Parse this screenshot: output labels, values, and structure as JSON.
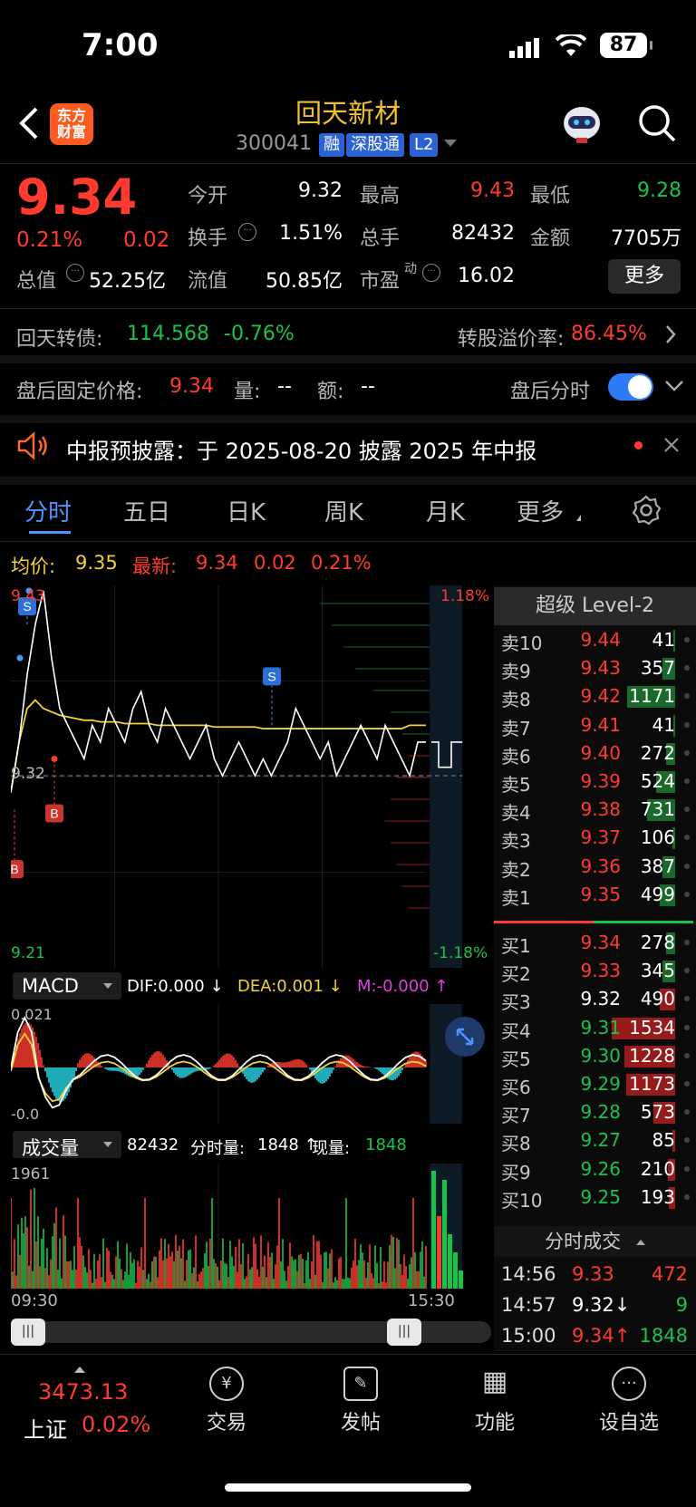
{
  "status": {
    "time": "7:00",
    "battery": "87"
  },
  "header": {
    "logo_line1": "东方",
    "logo_line2": "财富",
    "name": "回天新材",
    "code": "300041",
    "tags": [
      "融",
      "深股通",
      "L2"
    ]
  },
  "quote": {
    "price": "9.34",
    "pct": "0.21%",
    "chg": "0.02",
    "open_label": "今开",
    "open": "9.32",
    "high_label": "最高",
    "high": "9.43",
    "low_label": "最低",
    "low": "9.28",
    "turnover_label": "换手",
    "turnover": "1.51%",
    "volume_label": "总手",
    "volume": "82432",
    "amount_label": "金额",
    "amount": "7705万",
    "mktcap_label": "总值",
    "mktcap": "52.25亿",
    "float_label": "流值",
    "float": "50.85亿",
    "pe_label": "市盈",
    "pe_sup": "动",
    "pe": "16.02",
    "more": "更多"
  },
  "bond": {
    "label": "回天转债:",
    "price": "114.568",
    "pct": "-0.76%",
    "premium_label": "转股溢价率:",
    "premium": "86.45%"
  },
  "after_hours": {
    "label": "盘后固定价格:",
    "price": "9.34",
    "vol_label": "量:",
    "vol": "--",
    "amt_label": "额:",
    "amt": "--",
    "toggle_label": "盘后分时",
    "toggle_on": true
  },
  "notice": {
    "text": "中报预披露：于 2025-08-20 披露 2025 年中报"
  },
  "tabs": [
    "分时",
    "五日",
    "日K",
    "周K",
    "月K",
    "更多"
  ],
  "chart_info": {
    "avg_label": "均价:",
    "avg": "9.35",
    "latest_label": "最新:",
    "latest": "9.34",
    "chg": "0.02",
    "pct": "0.21%"
  },
  "chart_data": {
    "type": "line",
    "price_high": "9.43",
    "price_low": "9.21",
    "ref": "9.32",
    "pct_high": "1.18%",
    "pct_low": "-1.18%",
    "time_start": "09:30",
    "time_end": "15:30",
    "ylim": [
      9.21,
      9.43
    ],
    "price": [
      9.31,
      9.34,
      9.38,
      9.41,
      9.43,
      9.39,
      9.36,
      9.35,
      9.34,
      9.33,
      9.35,
      9.34,
      9.36,
      9.35,
      9.34,
      9.36,
      9.37,
      9.35,
      9.34,
      9.36,
      9.35,
      9.34,
      9.33,
      9.34,
      9.35,
      9.33,
      9.32,
      9.33,
      9.34,
      9.33,
      9.32,
      9.33,
      9.32,
      9.33,
      9.34,
      9.36,
      9.35,
      9.34,
      9.33,
      9.34,
      9.32,
      9.33,
      9.34,
      9.35,
      9.34,
      9.33,
      9.35,
      9.34,
      9.33,
      9.32,
      9.34,
      9.34
    ],
    "avg": [
      9.31,
      9.34,
      9.36,
      9.365,
      9.36,
      9.358,
      9.356,
      9.355,
      9.354,
      9.353,
      9.353,
      9.352,
      9.352,
      9.352,
      9.351,
      9.351,
      9.351,
      9.351,
      9.35,
      9.35,
      9.35,
      9.35,
      9.35,
      9.35,
      9.35,
      9.349,
      9.349,
      9.349,
      9.349,
      9.349,
      9.349,
      9.348,
      9.348,
      9.348,
      9.348,
      9.348,
      9.348,
      9.348,
      9.348,
      9.348,
      9.348,
      9.348,
      9.348,
      9.348,
      9.348,
      9.348,
      9.348,
      9.348,
      9.348,
      9.35,
      9.35,
      9.35
    ],
    "macd_label": "MACD",
    "dif": "DIF:0.000 ↓",
    "dea": "DEA:0.001 ↓",
    "m": "M:-0.000 ↑",
    "macd_top": "0.021",
    "macd_bottom": "-0.0",
    "vol_label": "成交量",
    "vol_total": "82432",
    "vol_min_label": "分时量:",
    "vol_min": "1848 ↑",
    "vol_now_label": "现量:",
    "vol_now": "1848",
    "vol_max": "1961"
  },
  "orderbook": {
    "title": "超级 Level-2",
    "asks": [
      {
        "label": "卖10",
        "price": "9.44",
        "vol": "41",
        "bar": 0.02,
        "color": "#ff3b30"
      },
      {
        "label": "卖9",
        "price": "9.43",
        "vol": "357",
        "bar": 0.2,
        "color": "#ff3b30"
      },
      {
        "label": "卖8",
        "price": "9.42",
        "vol": "1171",
        "bar": 0.76,
        "color": "#ff3b30"
      },
      {
        "label": "卖7",
        "price": "9.41",
        "vol": "41",
        "bar": 0.02,
        "color": "#ff3b30"
      },
      {
        "label": "卖6",
        "price": "9.40",
        "vol": "272",
        "bar": 0.15,
        "color": "#ff3b30"
      },
      {
        "label": "卖5",
        "price": "9.39",
        "vol": "524",
        "bar": 0.3,
        "color": "#ff3b30"
      },
      {
        "label": "卖4",
        "price": "9.38",
        "vol": "731",
        "bar": 0.45,
        "color": "#ff3b30"
      },
      {
        "label": "卖3",
        "price": "9.37",
        "vol": "106",
        "bar": 0.05,
        "color": "#ff3b30"
      },
      {
        "label": "卖2",
        "price": "9.36",
        "vol": "387",
        "bar": 0.2,
        "color": "#ff3b30"
      },
      {
        "label": "卖1",
        "price": "9.35",
        "vol": "499",
        "bar": 0.25,
        "color": "#ff3b30"
      }
    ],
    "bids": [
      {
        "label": "买1",
        "price": "9.34",
        "vol": "278",
        "bar": 0.15,
        "color": "#ff3b30"
      },
      {
        "label": "买2",
        "price": "9.33",
        "vol": "345",
        "bar": 0.2,
        "color": "#ff3b30"
      },
      {
        "label": "买3",
        "price": "9.32",
        "vol": "490",
        "bar": 0.25,
        "color": "#ffffff"
      },
      {
        "label": "买4",
        "price": "9.31",
        "vol": "1534",
        "bar": 1.0,
        "color": "#19c34a"
      },
      {
        "label": "买5",
        "price": "9.30",
        "vol": "1228",
        "bar": 0.8,
        "color": "#19c34a"
      },
      {
        "label": "买6",
        "price": "9.29",
        "vol": "1173",
        "bar": 0.77,
        "color": "#19c34a"
      },
      {
        "label": "买7",
        "price": "9.28",
        "vol": "573",
        "bar": 0.35,
        "color": "#19c34a"
      },
      {
        "label": "买8",
        "price": "9.27",
        "vol": "85",
        "bar": 0.05,
        "color": "#19c34a"
      },
      {
        "label": "买9",
        "price": "9.26",
        "vol": "210",
        "bar": 0.12,
        "color": "#19c34a"
      },
      {
        "label": "买10",
        "price": "9.25",
        "vol": "193",
        "bar": 0.1,
        "color": "#19c34a"
      }
    ]
  },
  "ticks": {
    "title": "分时成交",
    "rows": [
      {
        "time": "14:56",
        "price": "9.33",
        "vol": "472",
        "pcolor": "#ff3b30",
        "vcolor": "#ff3b30"
      },
      {
        "time": "14:57",
        "price": "9.32↓",
        "vol": "9",
        "pcolor": "#ffffff",
        "vcolor": "#19c34a"
      },
      {
        "time": "15:00",
        "price": "9.34↑",
        "vol": "1848",
        "pcolor": "#ff3b30",
        "vcolor": "#19c34a"
      }
    ]
  },
  "bottom": {
    "index_value": "3473.13",
    "index_name": "上证",
    "index_pct": "0.02%",
    "nav": [
      {
        "label": "交易",
        "icon": "¥"
      },
      {
        "label": "发帖",
        "icon": "✎"
      },
      {
        "label": "功能",
        "icon": "▦"
      },
      {
        "label": "设自选",
        "icon": "···"
      }
    ]
  },
  "colors": {
    "up": "#ff3b30",
    "down": "#19c34a",
    "accent": "#4c95ff",
    "name": "#f0c030"
  }
}
